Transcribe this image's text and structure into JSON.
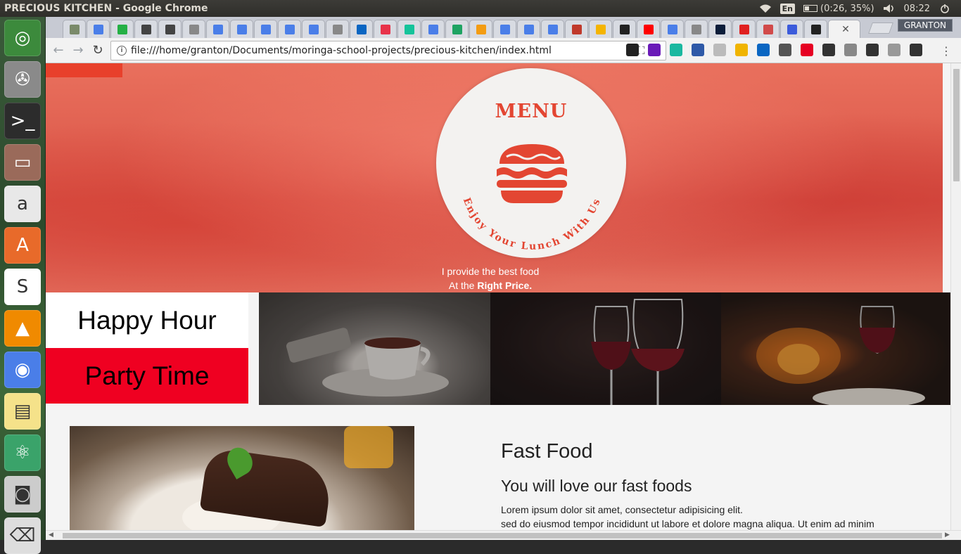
{
  "window": {
    "title": "PRECIOUS KITCHEN - Google Chrome"
  },
  "panel": {
    "language": "En",
    "battery": "(0:26, 35%)",
    "clock": "08:22"
  },
  "browser": {
    "url": "file:///home/granton/Documents/moringa-school-projects/precious-kitchen/index.html",
    "profile": "GRANTON"
  },
  "tabs": [
    {
      "icon": "tree-icon",
      "color": "#7a8a6a"
    },
    {
      "icon": "docs-icon",
      "color": "#4a7ee8"
    },
    {
      "icon": "whatsapp-icon",
      "color": "#25b045"
    },
    {
      "icon": "dropdown-icon",
      "color": "#444444"
    },
    {
      "icon": "dropdown-icon",
      "color": "#444444"
    },
    {
      "icon": "page-icon",
      "color": "#888888"
    },
    {
      "icon": "docs-icon",
      "color": "#4a7ee8"
    },
    {
      "icon": "docs-icon",
      "color": "#4a7ee8"
    },
    {
      "icon": "docs-icon",
      "color": "#4a7ee8"
    },
    {
      "icon": "docs-icon",
      "color": "#4a7ee8"
    },
    {
      "icon": "docs-icon",
      "color": "#4a7ee8"
    },
    {
      "icon": "page-icon",
      "color": "#888888"
    },
    {
      "icon": "linkedin-icon",
      "color": "#0a66c2"
    },
    {
      "icon": "hexagon-icon",
      "color": "#e8334a"
    },
    {
      "icon": "grammarly-icon",
      "color": "#15c39a"
    },
    {
      "icon": "docs-icon",
      "color": "#4a7ee8"
    },
    {
      "icon": "drive-icon",
      "color": "#1ea362"
    },
    {
      "icon": "plus8-icon",
      "color": "#f39c12"
    },
    {
      "icon": "docs-icon",
      "color": "#4a7ee8"
    },
    {
      "icon": "docs-icon",
      "color": "#4a7ee8"
    },
    {
      "icon": "docs-icon",
      "color": "#4a7ee8"
    },
    {
      "icon": "photo-icon",
      "color": "#c0392b"
    },
    {
      "icon": "slides-icon",
      "color": "#f4b400"
    },
    {
      "icon": "github-icon",
      "color": "#222222"
    },
    {
      "icon": "youtube-icon",
      "color": "#ff0000"
    },
    {
      "icon": "docs-icon",
      "color": "#4a7ee8"
    },
    {
      "icon": "page-icon",
      "color": "#888888"
    },
    {
      "icon": "pluralsight-icon",
      "color": "#0b1d3a"
    },
    {
      "icon": "record-icon",
      "color": "#e02020"
    },
    {
      "icon": "cube-icon",
      "color": "#d14a4a"
    },
    {
      "icon": "edit-icon",
      "color": "#3b5bdb"
    },
    {
      "icon": "github-icon",
      "color": "#222222"
    }
  ],
  "extensions": [
    {
      "icon": "instagram-icon",
      "color": "#222222"
    },
    {
      "icon": "h-icon",
      "color": "#6a1ab8"
    },
    {
      "icon": "m-icon",
      "color": "#1ab8a0"
    },
    {
      "icon": "search-ext-icon",
      "color": "#2f5aa8"
    },
    {
      "icon": "circle-ext-icon",
      "color": "#bbbbbb"
    },
    {
      "icon": "json-icon",
      "color": "#f0b400"
    },
    {
      "icon": "linkedin-icon",
      "color": "#0a66c2"
    },
    {
      "icon": "gmail-icon",
      "color": "#555555"
    },
    {
      "icon": "pinterest-icon",
      "color": "#e60023"
    },
    {
      "icon": "dots-ext-icon",
      "color": "#333333"
    },
    {
      "icon": "pen-icon",
      "color": "#888888"
    },
    {
      "icon": "film-icon",
      "color": "#333333"
    },
    {
      "icon": "s-icon",
      "color": "#999999"
    },
    {
      "icon": "car-icon",
      "color": "#333333"
    }
  ],
  "launcher": [
    {
      "name": "ubuntu-icon",
      "color": "#3c8a3c",
      "glyph": "◎"
    },
    {
      "name": "settings-icon",
      "color": "#8a8a8a",
      "glyph": "✇"
    },
    {
      "name": "terminal-icon",
      "color": "#2c2c2c",
      "glyph": ">_"
    },
    {
      "name": "files-icon",
      "color": "#9a6a5a",
      "glyph": "▭"
    },
    {
      "name": "amazon-icon",
      "color": "#e8e8e8",
      "glyph": "a"
    },
    {
      "name": "software-center-icon",
      "color": "#e86a2a",
      "glyph": "A"
    },
    {
      "name": "slack-icon",
      "color": "#ffffff",
      "glyph": "S"
    },
    {
      "name": "vlc-icon",
      "color": "#f08a00",
      "glyph": "▲"
    },
    {
      "name": "chrome-icon",
      "color": "#4a7ee8",
      "glyph": "◉"
    },
    {
      "name": "notes-icon",
      "color": "#f5e28a",
      "glyph": "▤"
    },
    {
      "name": "atom-icon",
      "color": "#3aa36a",
      "glyph": "⚛"
    },
    {
      "name": "camera-icon",
      "color": "#cccccc",
      "glyph": "◙"
    },
    {
      "name": "trash-icon",
      "color": "#dddddd",
      "glyph": "⌫"
    }
  ],
  "hero": {
    "menu": "MENU",
    "tagline": "Enjoy Your Lunch With Us",
    "line1": "I provide the best food",
    "line2_prefix": "At the ",
    "line2_bold": "Right Price."
  },
  "strip": {
    "happy": "Happy Hour",
    "party": "Party Time"
  },
  "content": {
    "title": "Fast Food",
    "subtitle": "You will love our fast foods",
    "p1": "Lorem ipsum dolor sit amet, consectetur adipisicing elit.",
    "p2": "sed do eiusmod tempor incididunt ut labore et dolore magna aliqua. Ut enim ad minim"
  }
}
